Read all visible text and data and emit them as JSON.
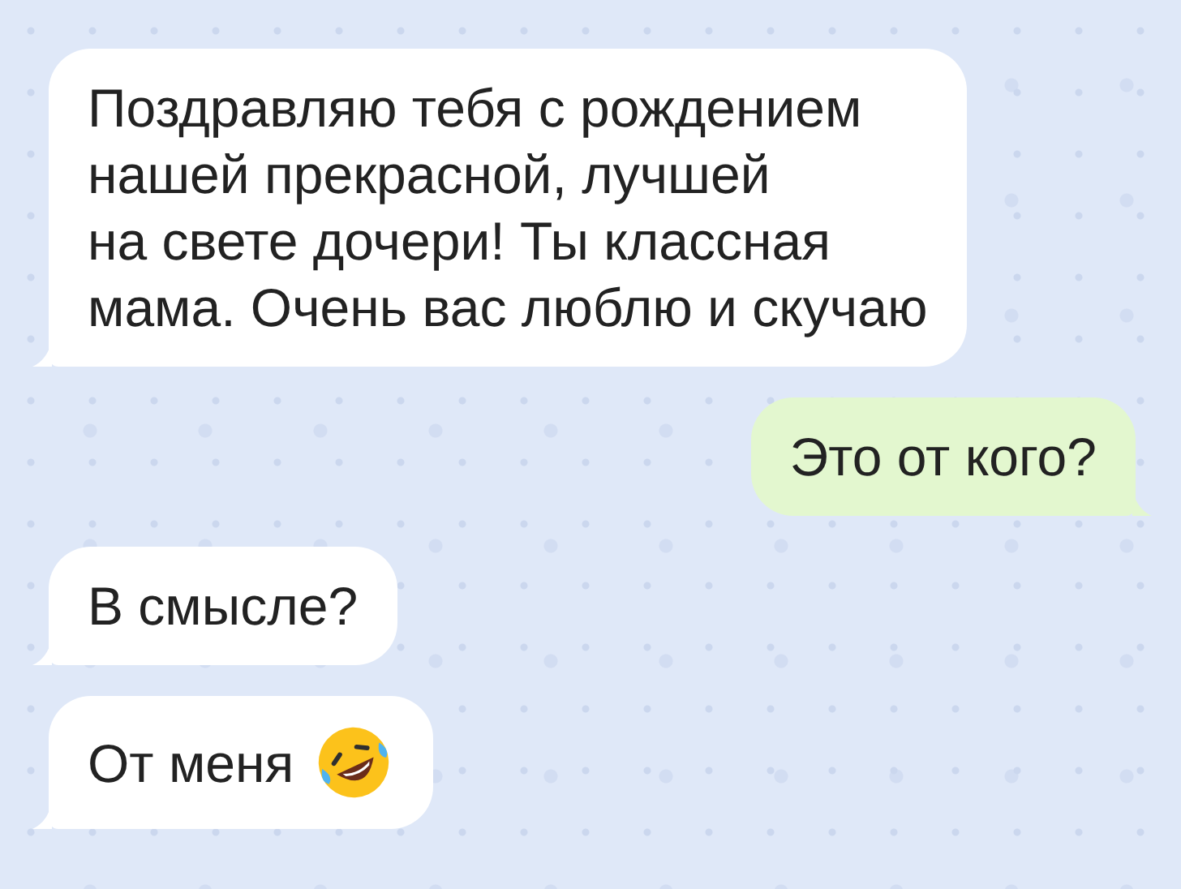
{
  "messages": [
    {
      "kind": "incoming",
      "text": "Поздравляю тебя с рождением\nнашей прекрасной, лучшей\nна свете дочери! Ты классная\nмама. Очень вас люблю и скучаю",
      "trailing_icon": false
    },
    {
      "kind": "outgoing",
      "text": "Это от кого?",
      "trailing_icon": false
    },
    {
      "kind": "incoming",
      "text": "В смысле?",
      "trailing_icon": false
    },
    {
      "kind": "incoming",
      "text": "От меня",
      "trailing_icon": true
    }
  ]
}
